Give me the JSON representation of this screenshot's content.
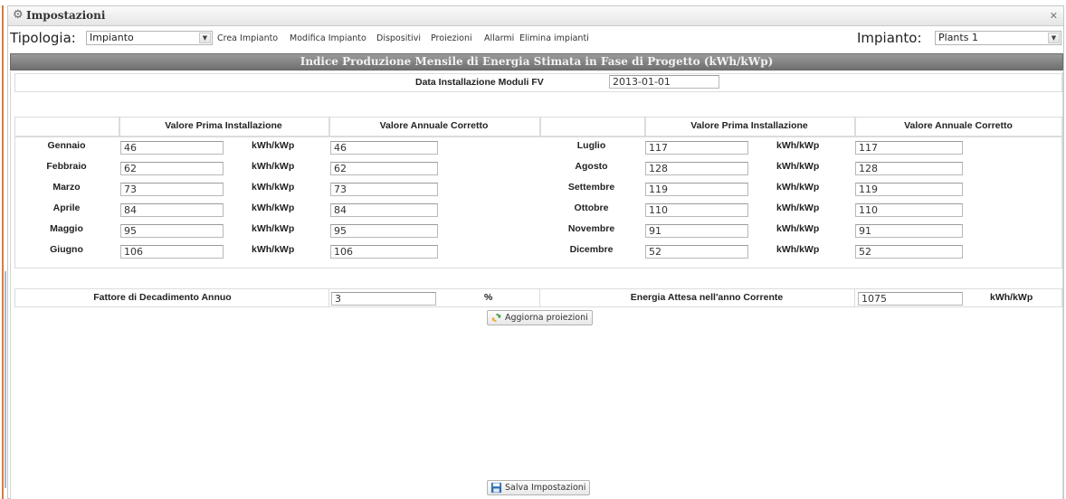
{
  "window": {
    "title": "Impostazioni"
  },
  "toolbar": {
    "tipologia_label": "Tipologia:",
    "tipologia_value": "Impianto",
    "links": [
      "Crea Impianto",
      "Modifica Impianto",
      "Dispositivi",
      "Proiezioni",
      "Allarmi",
      "Elimina impianti"
    ],
    "impianto_label": "Impianto:",
    "impianto_value": "Plants 1"
  },
  "section": {
    "title": "Indice Produzione Mensile di Energia Stimata in Fase di Progetto (kWh/kWp)",
    "install_date_label": "Data Installazione Moduli FV",
    "install_date_value": "2013-01-01"
  },
  "headers": {
    "first_install": "Valore Prima Installazione",
    "annual_corrected": "Valore Annuale Corretto"
  },
  "unit": "kWh/kWp",
  "months_left": [
    {
      "name": "Gennaio",
      "first": "46",
      "annual": "46"
    },
    {
      "name": "Febbraio",
      "first": "62",
      "annual": "62"
    },
    {
      "name": "Marzo",
      "first": "73",
      "annual": "73"
    },
    {
      "name": "Aprile",
      "first": "84",
      "annual": "84"
    },
    {
      "name": "Maggio",
      "first": "95",
      "annual": "95"
    },
    {
      "name": "Giugno",
      "first": "106",
      "annual": "106"
    }
  ],
  "months_right": [
    {
      "name": "Luglio",
      "first": "117",
      "annual": "117"
    },
    {
      "name": "Agosto",
      "first": "128",
      "annual": "128"
    },
    {
      "name": "Settembre",
      "first": "119",
      "annual": "119"
    },
    {
      "name": "Ottobre",
      "first": "110",
      "annual": "110"
    },
    {
      "name": "Novembre",
      "first": "91",
      "annual": "91"
    },
    {
      "name": "Dicembre",
      "first": "52",
      "annual": "52"
    }
  ],
  "decay": {
    "label": "Fattore di Decadimento Annuo",
    "value": "3",
    "unit": "%"
  },
  "expected": {
    "label": "Energia Attesa nell'anno Corrente",
    "value": "1075",
    "unit": "kWh/kWp"
  },
  "buttons": {
    "update": "Aggiorna proiezioni",
    "save": "Salva Impostazioni"
  },
  "colors": {
    "header_bar": "#7d7d7d",
    "accent": "#e07c3a"
  }
}
